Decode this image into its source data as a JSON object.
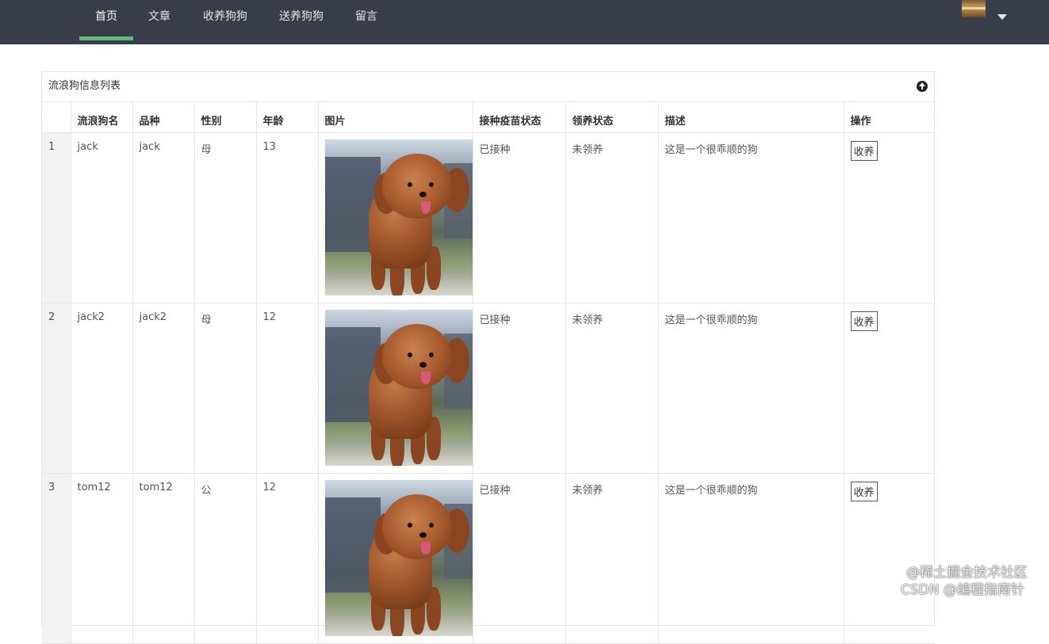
{
  "nav": {
    "items": [
      {
        "label": "首页",
        "active": true
      },
      {
        "label": "文章",
        "active": false
      },
      {
        "label": "收养狗狗",
        "active": false
      },
      {
        "label": "送养狗狗",
        "active": false
      },
      {
        "label": "留言",
        "active": false
      }
    ],
    "accent_color": "#5fb878",
    "bg_color": "#393d49"
  },
  "panel": {
    "title": "流浪狗信息列表",
    "collapse_icon": "arrow-up-circle-icon"
  },
  "table": {
    "columns": [
      "",
      "流浪狗名",
      "品种",
      "性别",
      "年龄",
      "图片",
      "接种疫苗状态",
      "领养状态",
      "描述",
      "操作"
    ],
    "rows": [
      {
        "index": "1",
        "name": "jack",
        "breed": "jack",
        "gender": "母",
        "age": "13",
        "photo": "poodle-dog-photo",
        "vaccine": "已接种",
        "adopt_status": "未领养",
        "description": "这是一个很乖顺的狗",
        "action": "收养"
      },
      {
        "index": "2",
        "name": "jack2",
        "breed": "jack2",
        "gender": "母",
        "age": "12",
        "photo": "poodle-dog-photo",
        "vaccine": "已接种",
        "adopt_status": "未领养",
        "description": "这是一个很乖顺的狗",
        "action": "收养"
      },
      {
        "index": "3",
        "name": "tom12",
        "breed": "tom12",
        "gender": "公",
        "age": "12",
        "photo": "poodle-dog-photo",
        "vaccine": "已接种",
        "adopt_status": "未领养",
        "description": "这是一个很乖顺的狗",
        "action": "收养"
      }
    ]
  },
  "watermark": {
    "line1": "@稀土掘金技术社区",
    "line2": "CSDN @编程指南针"
  }
}
